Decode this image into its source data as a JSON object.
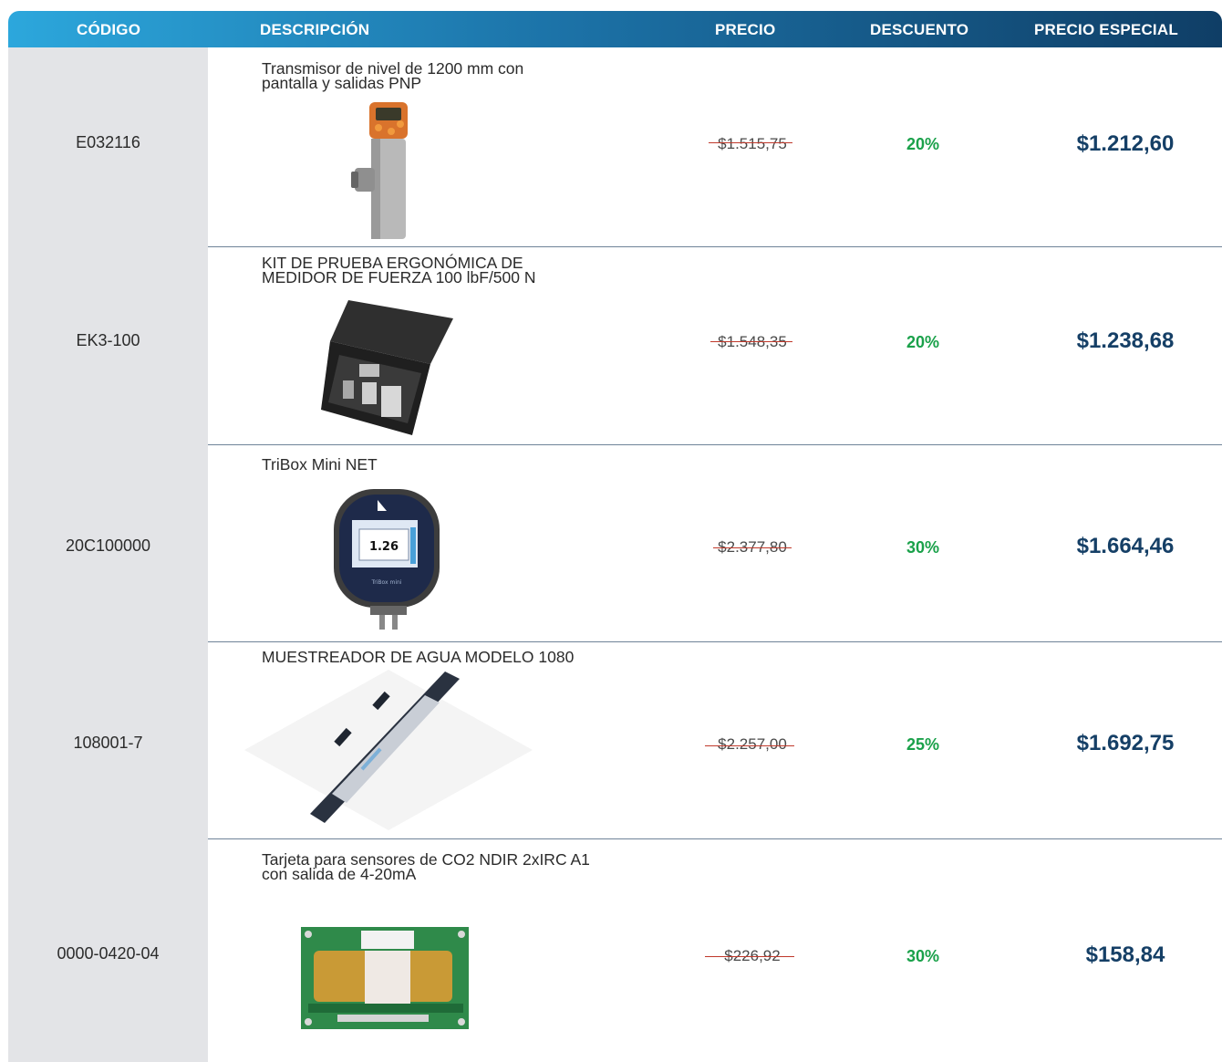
{
  "headers": {
    "code": "CÓDIGO",
    "description": "DESCRIPCIÓN",
    "price": "PRECIO",
    "discount": "DESCUENTO",
    "special_price": "PRECIO ESPECIAL"
  },
  "rows": [
    {
      "code": "E032116",
      "description": "Transmisor de nivel de 1200 mm con\npantalla y salidas PNP",
      "price": "$1.515,75",
      "discount": "20%",
      "special_price": "$1.212,60",
      "image": "level-transmitter-image"
    },
    {
      "code": "EK3-100",
      "description": "KIT DE PRUEBA ERGONÓMICA DE\nMEDIDOR DE FUERZA 100 lbF/500 N",
      "price": "$1.548,35",
      "discount": "20%",
      "special_price": "$1.238,68",
      "image": "force-gauge-kit-image"
    },
    {
      "code": "20C100000",
      "description": "TriBox Mini NET",
      "price": "$2.377,80",
      "discount": "30%",
      "special_price": "$1.664,46",
      "image": "tribox-mini-image",
      "screen_value": "1.26",
      "brand_text": "TriBox mini"
    },
    {
      "code": "108001-7",
      "description": "MUESTREADOR DE AGUA MODELO 1080",
      "price": "$2.257,00",
      "discount": "25%",
      "special_price": "$1.692,75",
      "image": "water-sampler-image"
    },
    {
      "code": "0000-0420-04",
      "description": "Tarjeta para sensores de CO2 NDIR 2xIRC A1\ncon salida de 4-20mA",
      "price": "$226,92",
      "discount": "30%",
      "special_price": "$158,84",
      "image": "co2-sensor-board-image"
    }
  ],
  "colors": {
    "header_start": "#2ca7dc",
    "header_end": "#0f3e66",
    "discount": "#1aa14a",
    "special_price": "#153f66",
    "strike": "#c0392b",
    "code_column": "#e3e4e7"
  }
}
